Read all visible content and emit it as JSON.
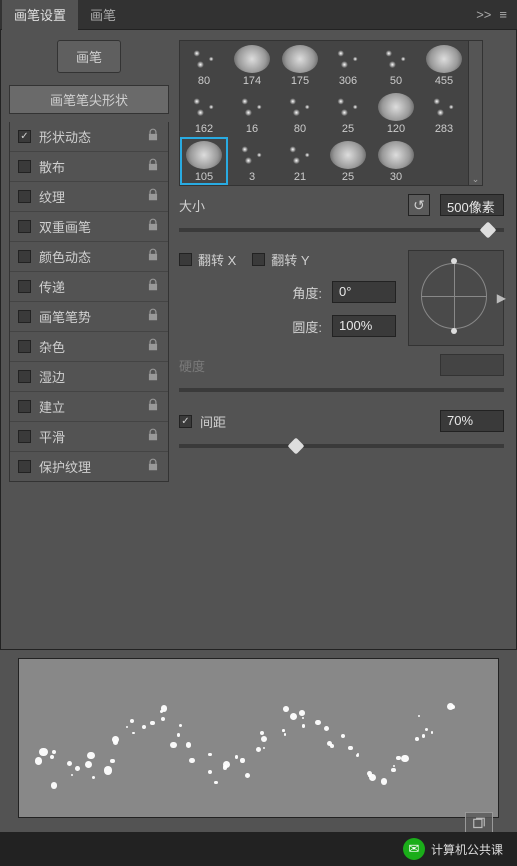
{
  "tabs": {
    "t1": "画笔设置",
    "t2": "画笔"
  },
  "sidebar": {
    "brush_btn": "画笔",
    "tip_shape": "画笔笔尖形状",
    "items": [
      {
        "label": "形状动态",
        "checked": true
      },
      {
        "label": "散布",
        "checked": false
      },
      {
        "label": "纹理",
        "checked": false
      },
      {
        "label": "双重画笔",
        "checked": false
      },
      {
        "label": "颜色动态",
        "checked": false
      },
      {
        "label": "传递",
        "checked": false
      },
      {
        "label": "画笔笔势",
        "checked": false
      },
      {
        "label": "杂色",
        "checked": false
      },
      {
        "label": "湿边",
        "checked": false
      },
      {
        "label": "建立",
        "checked": false
      },
      {
        "label": "平滑",
        "checked": false
      },
      {
        "label": "保护纹理",
        "checked": false
      }
    ]
  },
  "brushes": [
    {
      "n": "80"
    },
    {
      "n": "174"
    },
    {
      "n": "175"
    },
    {
      "n": "306"
    },
    {
      "n": "50"
    },
    {
      "n": "455"
    },
    {
      "n": "162"
    },
    {
      "n": "16"
    },
    {
      "n": "80"
    },
    {
      "n": "25"
    },
    {
      "n": "120"
    },
    {
      "n": "283"
    },
    {
      "n": "105",
      "sel": true
    },
    {
      "n": "3"
    },
    {
      "n": "21"
    },
    {
      "n": "25"
    },
    {
      "n": "30"
    }
  ],
  "props": {
    "size_label": "大小",
    "size_value": "500像素",
    "flip_x": "翻转 X",
    "flip_y": "翻转 Y",
    "angle_label": "角度:",
    "angle_value": "0°",
    "round_label": "圆度:",
    "round_value": "100%",
    "hardness_label": "硬度",
    "spacing_label": "间距",
    "spacing_value": "70%"
  },
  "footer": {
    "text": "计算机公共课"
  }
}
